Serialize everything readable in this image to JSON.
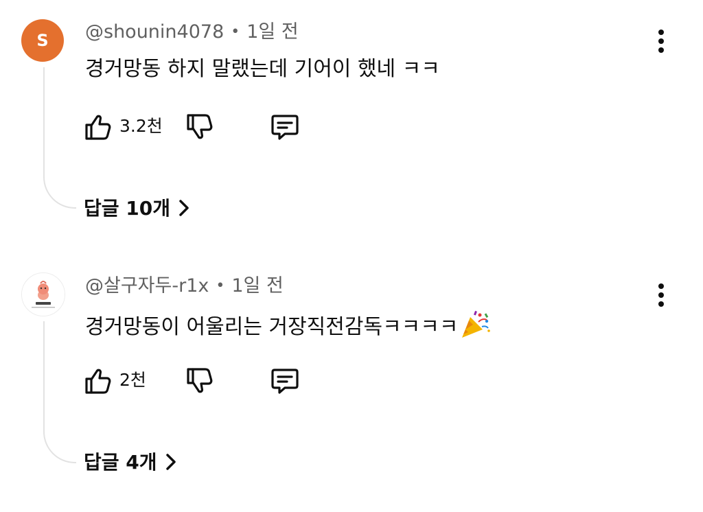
{
  "comments": [
    {
      "avatar_letter": "S",
      "avatar_color": "#e4702e",
      "author": "@shounin4078",
      "separator": "•",
      "time": "1일 전",
      "text": "경거망동 하지 말랬는데 기어이 했네 ㅋㅋ",
      "likes": "3.2천",
      "replies_label": "답글 10개"
    },
    {
      "avatar_icon": "character-avatar",
      "author": "@살구자두-r1x",
      "separator": "•",
      "time": "1일 전",
      "text": "경거망동이 어울리는 거장직전감독ㅋㅋㅋㅋ",
      "text_emoji": "party-popper-icon",
      "likes": "2천",
      "replies_label": "답글 4개"
    }
  ],
  "colors": {
    "text_primary": "#0f0f0f",
    "text_secondary": "#606060",
    "thread_line": "#e2e2e2"
  }
}
